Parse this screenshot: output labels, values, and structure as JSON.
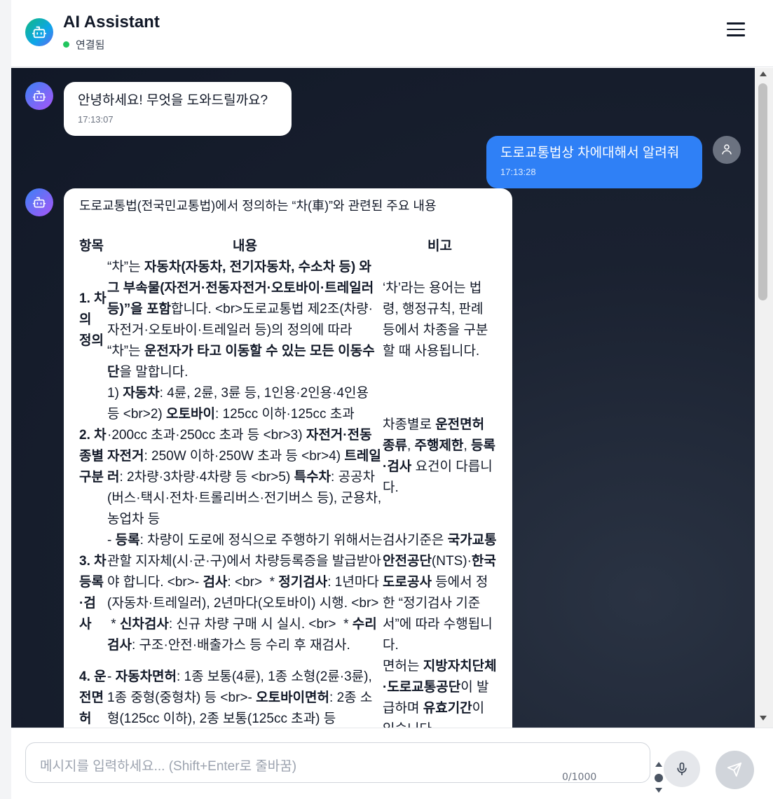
{
  "header": {
    "title": "AI Assistant",
    "status": "연결됨"
  },
  "messages": [
    {
      "role": "assistant",
      "text": "안녕하세요! 무엇을 도와드릴까요?",
      "time": "17:13:07"
    },
    {
      "role": "user",
      "text": "도로교통법상 차에대해서 알려줘",
      "time": "17:13:28"
    },
    {
      "role": "assistant",
      "intro": "도로교통법(전국민교통법)에서 정의하는 “차(車)”와 관련된 주요 내용"
    }
  ],
  "table": {
    "headers": [
      "항목",
      "내용",
      "비고"
    ],
    "rows": [
      {
        "item": "1. 차의 정의",
        "content": "“차”는 <b>자동차(자동차, 전기자동차, 수소차 등) 와 그 부속물(자전거·전동자전거·오토바이·트레일러 등)”을 포함</b>합니다. &lt;br&gt;도로교통법 제2조(차량·자전거·오토바이·트레일러 등)의 정의에 따라 “차”는 <b>운전자가 타고 이동할 수 있는 모든 이동수단</b>을 말합니다.",
        "note": "‘차’라는 용어는 법령, 행정규칙, 판례 등에서 차종을 구분할 때 사용됩니다."
      },
      {
        "item": "2. 차종별 구분",
        "content": "1) <b>자동차</b>: 4륜, 2륜, 3륜 등, 1인용·2인용·4인용 등 &lt;br&gt;2) <b>오토바이</b>: 125cc 이하·125cc 초과·200cc 초과·250cc 초과 등 &lt;br&gt;3) <b>자전거·전동자전거</b>: 250W 이하·250W 초과 등 &lt;br&gt;4) <b>트레일러</b>: 2차량·3차량·4차량 등 &lt;br&gt;5) <b>특수차</b>: 공공차(버스·택시·전차·트롤리버스·전기버스 등), 군용차, 농업차 등",
        "note": "차종별로 <b>운전면허 종류</b>, <b>주행제한</b>, <b>등록·검사</b> 요건이 다릅니다."
      },
      {
        "item": "3. 차 등록·검사",
        "content": "- <b>등록</b>: 차량이 도로에 정식으로 주행하기 위해서는 관할 지자체(시·군·구)에서 차량등록증을 발급받아야 합니다. &lt;br&gt;- <b>검사</b>: &lt;br&gt; &nbsp;* <b>정기검사</b>: 1년마다(자동차·트레일러), 2년마다(오토바이) 시행. &lt;br&gt; &nbsp;* <b>신차검사</b>: 신규 차량 구매 시 실시. &lt;br&gt; &nbsp;* <b>수리검사</b>: 구조·안전·배출가스 등 수리 후 재검사.",
        "note": "검사기준은 <b>국가교통안전공단</b>(NTS)·<b>한국도로공사</b> 등에서 정한 “정기검사 기준서”에 따라 수행됩니다."
      },
      {
        "item": "4. 운전면허",
        "content": "- <b>자동차면허</b>: 1종 보통(4륜), 1종 소형(2륜·3륜), 1종 중형(중형차) 등 &lt;br&gt;- <b>오토바이면허</b>: 2종 소형(125cc 이하), 2종 보통(125cc 초과) 등",
        "note": "면허는 <b>지방자치단체·도로교통공단</b>이 발급하며 <b>유효기간</b>이 있습니다."
      }
    ]
  },
  "input": {
    "placeholder": "메시지를 입력하세요... (Shift+Enter로 줄바꿈)",
    "counter": "0/1000"
  },
  "icons": {
    "logo": "robot-icon",
    "menu": "hamburger-menu-icon",
    "user": "user-icon",
    "mic": "microphone-icon",
    "send": "send-icon"
  },
  "colors": {
    "user_bubble": "#2f80f6",
    "status_dot": "#22c55e",
    "chat_bg": "#1a2130"
  }
}
